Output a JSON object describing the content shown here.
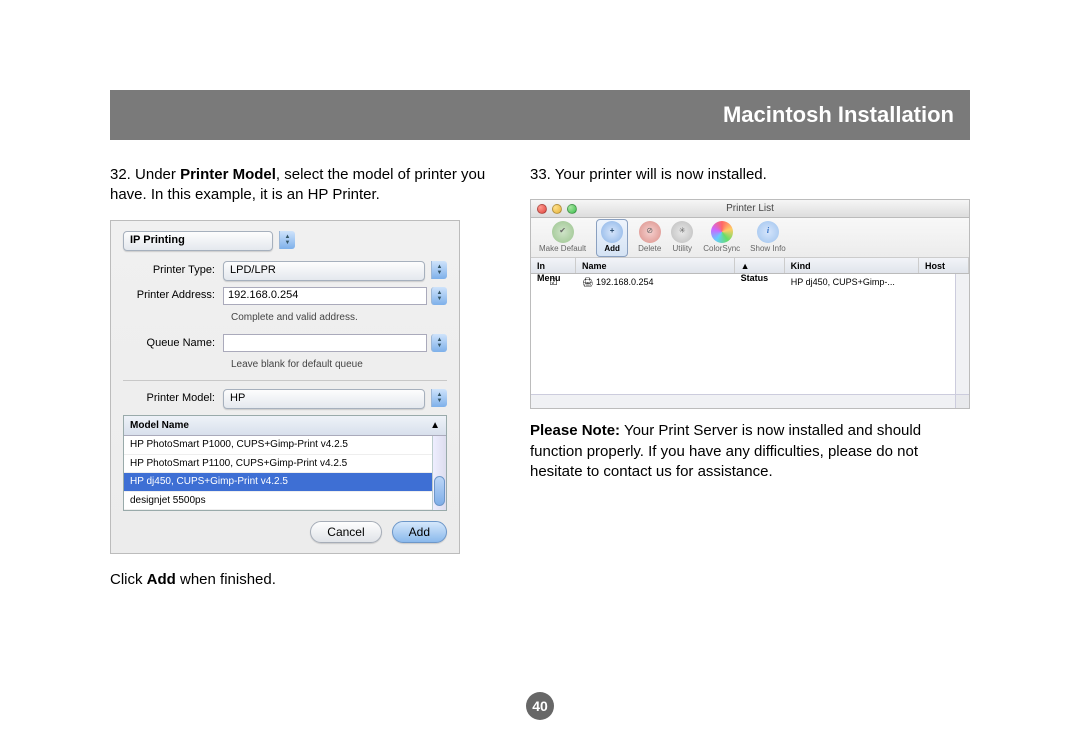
{
  "header": {
    "title": "Macintosh Installation"
  },
  "left": {
    "step_num": "32.",
    "step_a": "Under ",
    "step_bold1": "Printer Model",
    "step_b": ", select the model of printer you have. In this example, it is an HP Printer.",
    "click_a": "Click ",
    "click_bold": "Add",
    "click_b": " when finished."
  },
  "dialog": {
    "top_select": "IP Printing",
    "printer_type_lbl": "Printer Type:",
    "printer_type_val": "LPD/LPR",
    "printer_addr_lbl": "Printer Address:",
    "printer_addr_val": "192.168.0.254",
    "addr_hint": "Complete and valid address.",
    "queue_lbl": "Queue Name:",
    "queue_val": "",
    "queue_hint": "Leave blank for default queue",
    "printer_model_lbl": "Printer Model:",
    "printer_model_val": "HP",
    "model_header": "Model Name",
    "models": [
      "HP PhotoSmart P1000, CUPS+Gimp-Print v4.2.5",
      "HP PhotoSmart P1100, CUPS+Gimp-Print v4.2.5",
      "HP dj450, CUPS+Gimp-Print v4.2.5",
      "designjet 5500ps"
    ],
    "sel_index": 2,
    "cancel": "Cancel",
    "add": "Add"
  },
  "right": {
    "step_num": "33.",
    "step_text": "Your printer will is now installed.",
    "note_bold": "Please Note:",
    "note_text": " Your Print Server is now installed and should function properly. If you have any difficulties, please do not hesitate to contact us for assistance."
  },
  "printer_list": {
    "title": "Printer List",
    "toolbar": {
      "make_default": "Make Default",
      "add": "Add",
      "delete": "Delete",
      "utility": "Utility",
      "colorsync": "ColorSync",
      "show_info": "Show Info"
    },
    "cols": {
      "inmenu": "In Menu",
      "name": "Name",
      "status": "Status",
      "kind": "Kind",
      "host": "Host"
    },
    "row": {
      "name": "192.168.0.254",
      "kind": "HP dj450, CUPS+Gimp-..."
    }
  },
  "page": "40"
}
